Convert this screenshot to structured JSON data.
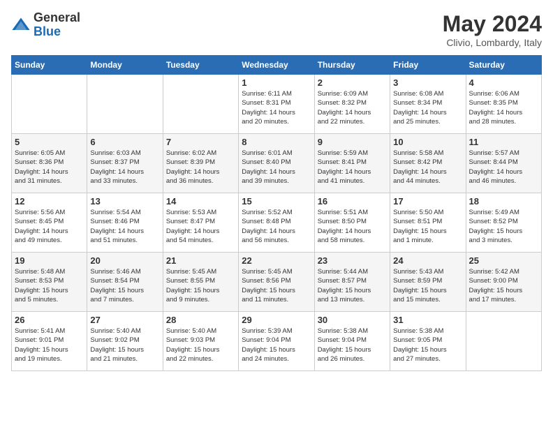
{
  "logo": {
    "general": "General",
    "blue": "Blue"
  },
  "title": "May 2024",
  "location": "Clivio, Lombardy, Italy",
  "days_of_week": [
    "Sunday",
    "Monday",
    "Tuesday",
    "Wednesday",
    "Thursday",
    "Friday",
    "Saturday"
  ],
  "weeks": [
    [
      {
        "day": "",
        "info": ""
      },
      {
        "day": "",
        "info": ""
      },
      {
        "day": "",
        "info": ""
      },
      {
        "day": "1",
        "info": "Sunrise: 6:11 AM\nSunset: 8:31 PM\nDaylight: 14 hours\nand 20 minutes."
      },
      {
        "day": "2",
        "info": "Sunrise: 6:09 AM\nSunset: 8:32 PM\nDaylight: 14 hours\nand 22 minutes."
      },
      {
        "day": "3",
        "info": "Sunrise: 6:08 AM\nSunset: 8:34 PM\nDaylight: 14 hours\nand 25 minutes."
      },
      {
        "day": "4",
        "info": "Sunrise: 6:06 AM\nSunset: 8:35 PM\nDaylight: 14 hours\nand 28 minutes."
      }
    ],
    [
      {
        "day": "5",
        "info": "Sunrise: 6:05 AM\nSunset: 8:36 PM\nDaylight: 14 hours\nand 31 minutes."
      },
      {
        "day": "6",
        "info": "Sunrise: 6:03 AM\nSunset: 8:37 PM\nDaylight: 14 hours\nand 33 minutes."
      },
      {
        "day": "7",
        "info": "Sunrise: 6:02 AM\nSunset: 8:39 PM\nDaylight: 14 hours\nand 36 minutes."
      },
      {
        "day": "8",
        "info": "Sunrise: 6:01 AM\nSunset: 8:40 PM\nDaylight: 14 hours\nand 39 minutes."
      },
      {
        "day": "9",
        "info": "Sunrise: 5:59 AM\nSunset: 8:41 PM\nDaylight: 14 hours\nand 41 minutes."
      },
      {
        "day": "10",
        "info": "Sunrise: 5:58 AM\nSunset: 8:42 PM\nDaylight: 14 hours\nand 44 minutes."
      },
      {
        "day": "11",
        "info": "Sunrise: 5:57 AM\nSunset: 8:44 PM\nDaylight: 14 hours\nand 46 minutes."
      }
    ],
    [
      {
        "day": "12",
        "info": "Sunrise: 5:56 AM\nSunset: 8:45 PM\nDaylight: 14 hours\nand 49 minutes."
      },
      {
        "day": "13",
        "info": "Sunrise: 5:54 AM\nSunset: 8:46 PM\nDaylight: 14 hours\nand 51 minutes."
      },
      {
        "day": "14",
        "info": "Sunrise: 5:53 AM\nSunset: 8:47 PM\nDaylight: 14 hours\nand 54 minutes."
      },
      {
        "day": "15",
        "info": "Sunrise: 5:52 AM\nSunset: 8:48 PM\nDaylight: 14 hours\nand 56 minutes."
      },
      {
        "day": "16",
        "info": "Sunrise: 5:51 AM\nSunset: 8:50 PM\nDaylight: 14 hours\nand 58 minutes."
      },
      {
        "day": "17",
        "info": "Sunrise: 5:50 AM\nSunset: 8:51 PM\nDaylight: 15 hours\nand 1 minute."
      },
      {
        "day": "18",
        "info": "Sunrise: 5:49 AM\nSunset: 8:52 PM\nDaylight: 15 hours\nand 3 minutes."
      }
    ],
    [
      {
        "day": "19",
        "info": "Sunrise: 5:48 AM\nSunset: 8:53 PM\nDaylight: 15 hours\nand 5 minutes."
      },
      {
        "day": "20",
        "info": "Sunrise: 5:46 AM\nSunset: 8:54 PM\nDaylight: 15 hours\nand 7 minutes."
      },
      {
        "day": "21",
        "info": "Sunrise: 5:45 AM\nSunset: 8:55 PM\nDaylight: 15 hours\nand 9 minutes."
      },
      {
        "day": "22",
        "info": "Sunrise: 5:45 AM\nSunset: 8:56 PM\nDaylight: 15 hours\nand 11 minutes."
      },
      {
        "day": "23",
        "info": "Sunrise: 5:44 AM\nSunset: 8:57 PM\nDaylight: 15 hours\nand 13 minutes."
      },
      {
        "day": "24",
        "info": "Sunrise: 5:43 AM\nSunset: 8:59 PM\nDaylight: 15 hours\nand 15 minutes."
      },
      {
        "day": "25",
        "info": "Sunrise: 5:42 AM\nSunset: 9:00 PM\nDaylight: 15 hours\nand 17 minutes."
      }
    ],
    [
      {
        "day": "26",
        "info": "Sunrise: 5:41 AM\nSunset: 9:01 PM\nDaylight: 15 hours\nand 19 minutes."
      },
      {
        "day": "27",
        "info": "Sunrise: 5:40 AM\nSunset: 9:02 PM\nDaylight: 15 hours\nand 21 minutes."
      },
      {
        "day": "28",
        "info": "Sunrise: 5:40 AM\nSunset: 9:03 PM\nDaylight: 15 hours\nand 22 minutes."
      },
      {
        "day": "29",
        "info": "Sunrise: 5:39 AM\nSunset: 9:04 PM\nDaylight: 15 hours\nand 24 minutes."
      },
      {
        "day": "30",
        "info": "Sunrise: 5:38 AM\nSunset: 9:04 PM\nDaylight: 15 hours\nand 26 minutes."
      },
      {
        "day": "31",
        "info": "Sunrise: 5:38 AM\nSunset: 9:05 PM\nDaylight: 15 hours\nand 27 minutes."
      },
      {
        "day": "",
        "info": ""
      }
    ]
  ]
}
